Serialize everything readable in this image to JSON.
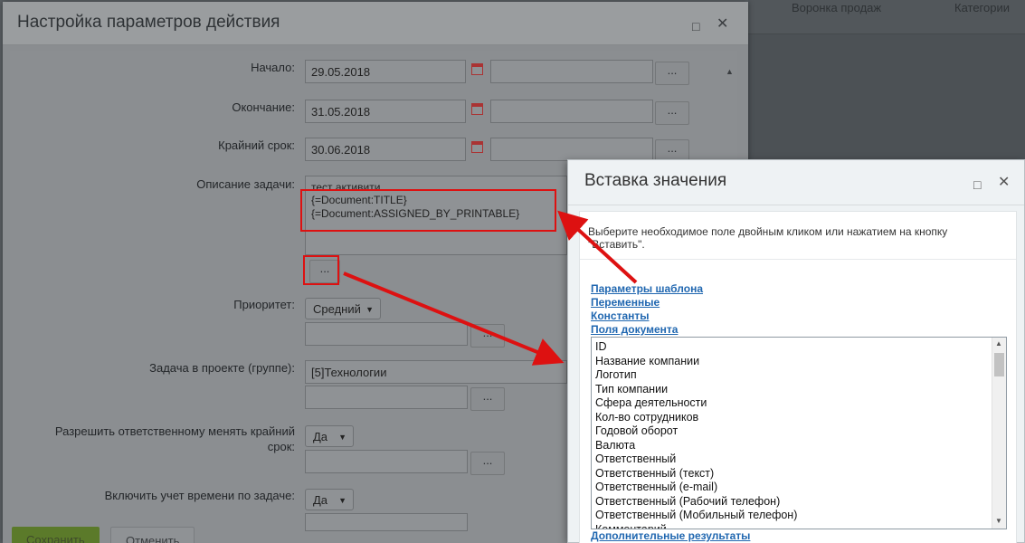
{
  "background": {
    "tabs": [
      "Воронка продаж",
      "Категории"
    ]
  },
  "main_dialog": {
    "title": "Настройка параметров действия",
    "fields": {
      "start": {
        "label": "Начало:",
        "value": "29.05.2018"
      },
      "end": {
        "label": "Окончание:",
        "value": "31.05.2018"
      },
      "deadline": {
        "label": "Крайний срок:",
        "value": "30.06.2018"
      },
      "description": {
        "label": "Описание задачи:",
        "lines": [
          "тест активити",
          "{=Document:TITLE}",
          "{=Document:ASSIGNED_BY_PRINTABLE}"
        ]
      },
      "priority": {
        "label": "Приоритет:",
        "value": "Средний"
      },
      "project": {
        "label": "Задача в проекте (группе):",
        "value": "[5]Технологии"
      },
      "allow_change_deadline": {
        "label_line1": "Разрешить ответственному менять крайний",
        "label_line2": "срок:",
        "value": "Да"
      },
      "time_tracking": {
        "label": "Включить учет времени по задаче:",
        "value": "Да"
      }
    },
    "dots_label": "...",
    "buttons": {
      "save": "Сохранить",
      "cancel": "Отменить"
    }
  },
  "insert_dialog": {
    "title": "Вставка значения",
    "hint": "Выберите необходимое поле двойным кликом или нажатием на кнопку \"Вставить\".",
    "links": [
      "Параметры шаблона",
      "Переменные",
      "Константы",
      "Поля документа"
    ],
    "list_items": [
      "ID",
      "Название компании",
      "Логотип",
      "Тип компании",
      "Сфера деятельности",
      "Кол-во сотрудников",
      "Годовой оборот",
      "Валюта",
      "Ответственный",
      "Ответственный (текст)",
      "Ответственный (e-mail)",
      "Ответственный (Рабочий телефон)",
      "Ответственный (Мобильный телефон)",
      "Комментарий"
    ],
    "extra_link": "Дополнительные результаты"
  },
  "colors": {
    "annotation_red": "#d11111",
    "link_blue": "#2067b0"
  }
}
